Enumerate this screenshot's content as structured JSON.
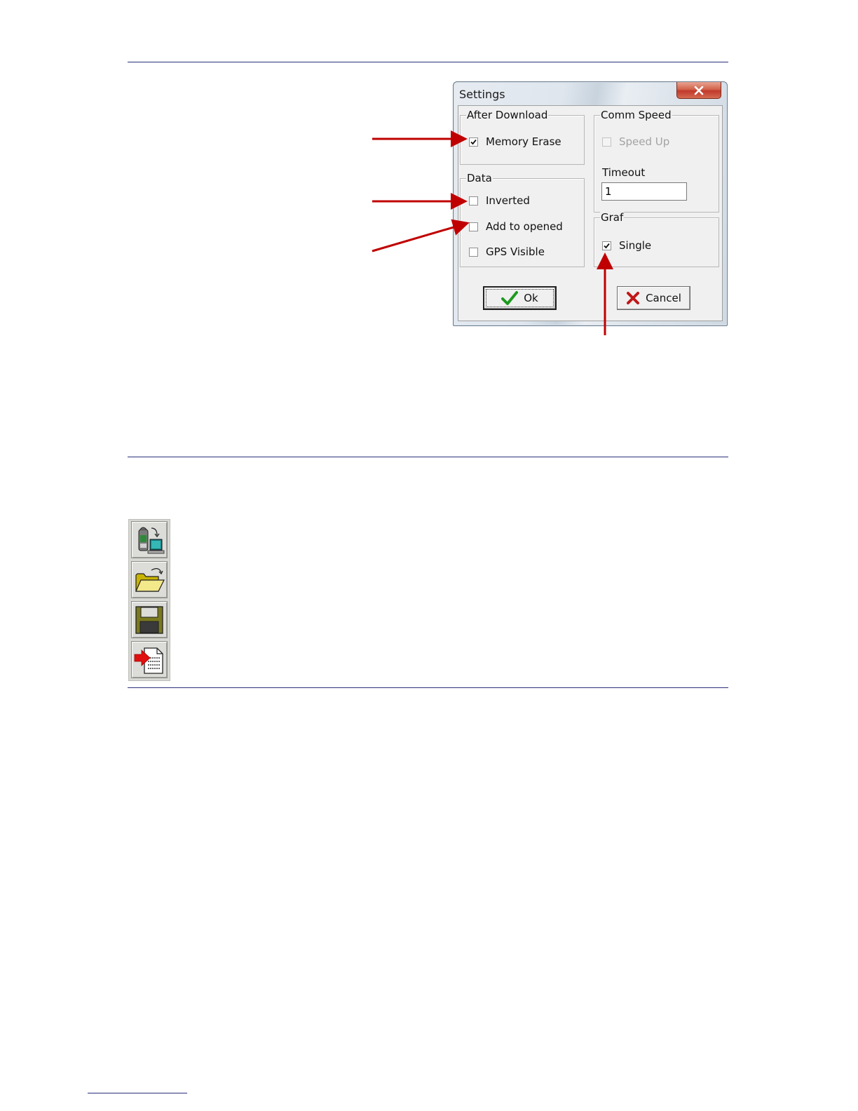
{
  "dialog": {
    "title": "Settings",
    "after_download": {
      "legend": "After Download",
      "memory_erase": {
        "label": "Memory Erase",
        "checked": true
      }
    },
    "comm_speed": {
      "legend": "Comm Speed",
      "speed_up": {
        "label": "Speed Up",
        "checked": false,
        "disabled": true
      },
      "timeout_label": "Timeout",
      "timeout_value": "1"
    },
    "data": {
      "legend": "Data",
      "inverted": {
        "label": "Inverted",
        "checked": false
      },
      "add_to_opened": {
        "label": "Add to opened",
        "checked": false
      },
      "gps_visible": {
        "label": "GPS Visible",
        "checked": false
      }
    },
    "graf": {
      "legend": "Graf",
      "single": {
        "label": "Single",
        "checked": true
      }
    },
    "ok_label": "Ok",
    "cancel_label": "Cancel"
  },
  "toolbar": {
    "buttons": [
      {
        "icon": "download-from-device-icon"
      },
      {
        "icon": "open-folder-icon"
      },
      {
        "icon": "save-disk-icon"
      },
      {
        "icon": "export-report-icon"
      }
    ]
  },
  "colors": {
    "rule": "#2b2f7a",
    "annotation_arrow": "#c00000",
    "check_green": "#1f9a1f",
    "cancel_red": "#c01818"
  }
}
